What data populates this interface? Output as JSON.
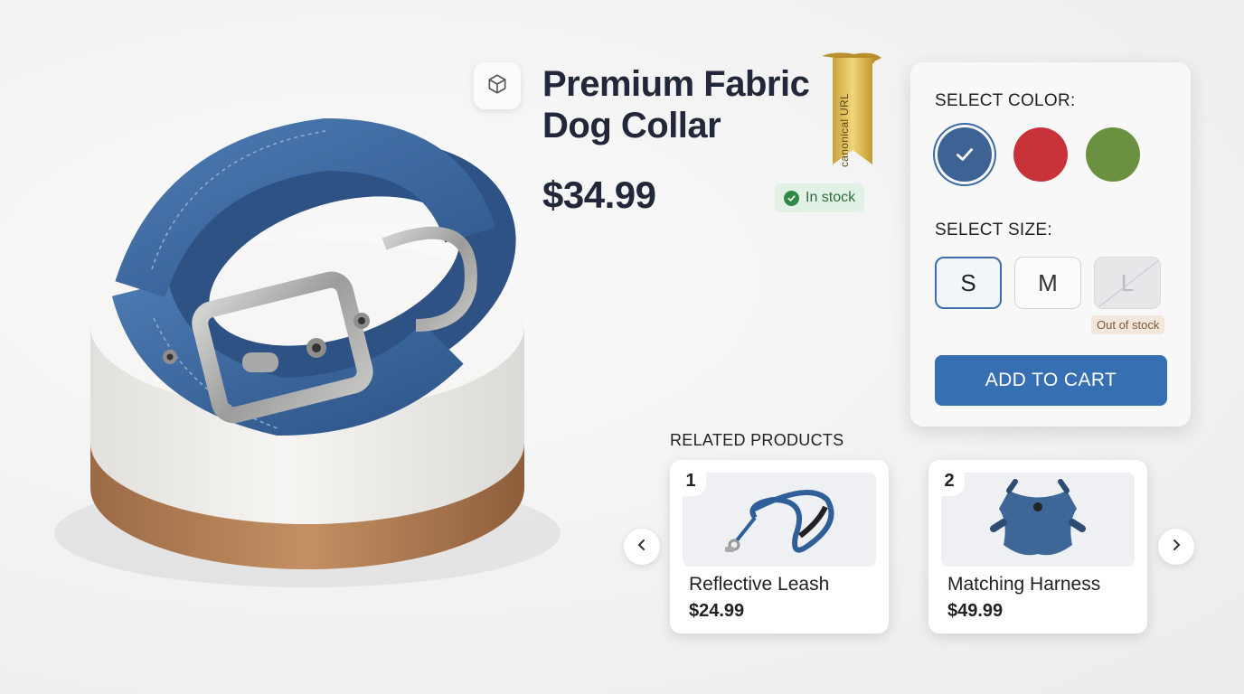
{
  "product": {
    "title": "Premium Fabric Dog Collar",
    "price": "$34.99",
    "stock_status": "In stock",
    "ribbon_text": "canonical URL",
    "icons": {
      "view_3d": "cube-icon",
      "stock": "check-circle-icon"
    }
  },
  "options": {
    "color_label": "SELECT COLOR:",
    "colors": [
      {
        "name": "blue",
        "hex": "#3d6394",
        "selected": true
      },
      {
        "name": "red",
        "hex": "#c8333a",
        "selected": false
      },
      {
        "name": "green",
        "hex": "#6a9140",
        "selected": false
      }
    ],
    "size_label": "SELECT SIZE:",
    "sizes": [
      {
        "label": "S",
        "selected": true,
        "available": true
      },
      {
        "label": "M",
        "selected": false,
        "available": true
      },
      {
        "label": "L",
        "selected": false,
        "available": false
      }
    ],
    "out_of_stock_label": "Out of stock",
    "add_to_cart": "ADD TO CART"
  },
  "related": {
    "title": "RELATED PRODUCTS",
    "items": [
      {
        "index": "1",
        "name": "Reflective Leash",
        "price": "$24.99"
      },
      {
        "index": "2",
        "name": "Matching Harness",
        "price": "$49.99"
      }
    ],
    "prev_icon": "chevron-left-icon",
    "next_icon": "chevron-right-icon"
  },
  "colors": {
    "accent": "#3670b3",
    "text": "#22283a",
    "in_stock": "#2f8a48"
  }
}
